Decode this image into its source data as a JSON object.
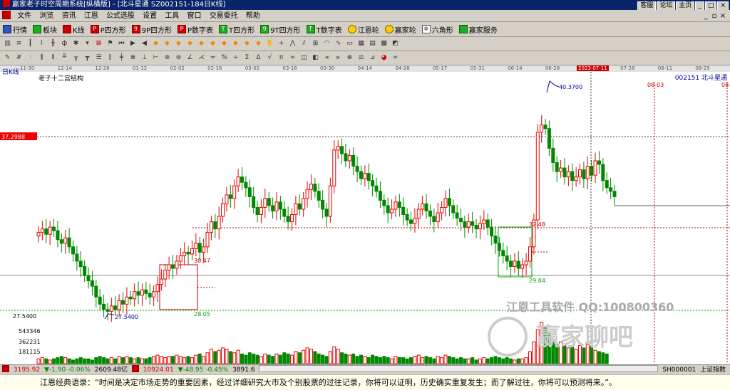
{
  "window": {
    "title": "赢家老子时空周期系统[纵横版] - [北斗星通  SZ002151-184日K线]",
    "right_buttons": [
      "客服",
      "论坛",
      "主页",
      "_",
      "□",
      "×"
    ]
  },
  "menu": [
    "文件",
    "浏览",
    "资讯",
    "江恩",
    "公式选股",
    "设置",
    "工具",
    "窗口",
    "交易委托",
    "帮助"
  ],
  "toolbar1": [
    {
      "label": "行情",
      "icon": "quote-icon"
    },
    {
      "label": "板块",
      "icon": "sector-icon"
    },
    {
      "label": "K线",
      "icon": "kline-icon"
    },
    {
      "label": "P四方形",
      "icon": "p-square-icon"
    },
    {
      "label": "9P四方形",
      "icon": "9p-square-icon"
    },
    {
      "label": "P数字表",
      "icon": "p-table-icon"
    },
    {
      "label": "T四方形",
      "icon": "t-square-icon"
    },
    {
      "label": "9T四方形",
      "icon": "9t-square-icon"
    },
    {
      "label": "T数字表",
      "icon": "t-table-icon"
    },
    {
      "label": "江恩轮",
      "icon": "gann-wheel-icon"
    },
    {
      "label": "赢家轮",
      "icon": "winner-wheel-icon"
    },
    {
      "label": "六角形",
      "icon": "hexagon-icon"
    },
    {
      "label": "赢家服务",
      "icon": "service-icon"
    }
  ],
  "date_axis": {
    "labels": [
      "11-30",
      "12-14",
      "12-28",
      "01-12",
      "02-02",
      "02-16",
      "03-02",
      "03-16",
      "03-30",
      "04-14",
      "04-28",
      "05-17",
      "05-31",
      "06-14",
      "06-28",
      "2023-07-11",
      "07-28",
      "08-11",
      "08-25"
    ],
    "selected": "2023-07-11"
  },
  "chart_header": {
    "ktype": "日K线",
    "indicator_name": "老子十二宫结构",
    "symbol": "002151  北斗星通"
  },
  "chart_data": {
    "type": "candlestick",
    "price_axis_labels": [
      "37.2988",
      "27.5400"
    ],
    "volume_axis_labels": [
      "543346",
      "362231",
      "181115"
    ],
    "annotations": [
      "40.3700",
      "27.5400",
      "30.47",
      "28.05",
      "32.48",
      "29.84",
      "08-03",
      "08-2"
    ],
    "watermark": [
      "江恩工具软件 QQ:100800360",
      "赢家聊吧"
    ],
    "closes": [
      32.2,
      32.4,
      32.1,
      32.5,
      32.3,
      31.8,
      31.6,
      31.9,
      31.4,
      31.0,
      30.6,
      30.3,
      29.8,
      29.5,
      29.2,
      28.6,
      28.2,
      27.9,
      27.8,
      28.1,
      27.9,
      28.4,
      28.2,
      28.6,
      28.5,
      28.9,
      28.7,
      29.0,
      28.8,
      28.6,
      28.9,
      29.3,
      29.6,
      30.1,
      30.4,
      30.2,
      30.6,
      30.9,
      31.1,
      31.0,
      31.3,
      31.6,
      31.1,
      31.4,
      32.2,
      32.8,
      32.4,
      33.1,
      33.8,
      34.3,
      34.1,
      34.8,
      35.3,
      35.0,
      34.7,
      34.2,
      33.6,
      33.2,
      33.6,
      34.1,
      33.7,
      33.4,
      33.9,
      33.5,
      33.1,
      32.8,
      33.2,
      33.8,
      33.5,
      34.1,
      34.6,
      34.9,
      34.5,
      34.0,
      33.5,
      33.1,
      34.8,
      36.8,
      37.0,
      36.6,
      36.2,
      36.5,
      35.9,
      35.6,
      35.2,
      35.5,
      35.1,
      34.8,
      34.5,
      34.0,
      33.7,
      33.3,
      33.5,
      33.9,
      33.6,
      33.2,
      32.9,
      32.7,
      33.0,
      33.5,
      33.8,
      33.4,
      33.1,
      32.8,
      33.3,
      33.6,
      34.1,
      33.7,
      33.3,
      33.0,
      32.8,
      32.5,
      32.8,
      32.6,
      32.4,
      32.7,
      32.9,
      32.5,
      32.0,
      31.6,
      31.2,
      30.9,
      30.6,
      30.3,
      30.6,
      30.2,
      30.4,
      30.6,
      31.4,
      32.9,
      37.8,
      38.2,
      38.0,
      36.9,
      36.1,
      35.6,
      35.8,
      35.3,
      35.6,
      35.1,
      35.3,
      35.7,
      35.2,
      35.9,
      35.4,
      36.2,
      36.0,
      35.1,
      34.7,
      34.5,
      34.2
    ],
    "volume": [
      4,
      5,
      4,
      3,
      4,
      5,
      6,
      5,
      4,
      3,
      4,
      5,
      4,
      4,
      3,
      5,
      6,
      5,
      4,
      5,
      4,
      6,
      5,
      6,
      5,
      4,
      5,
      4,
      4,
      5,
      6,
      7,
      6,
      5,
      6,
      6,
      7,
      6,
      5,
      6,
      5,
      7,
      8,
      6,
      9,
      12,
      10,
      11,
      13,
      12,
      10,
      9,
      11,
      8,
      7,
      9,
      8,
      7,
      6,
      8,
      7,
      6,
      8,
      7,
      9,
      8,
      7,
      10,
      9,
      11,
      13,
      12,
      10,
      8,
      7,
      6,
      10,
      14,
      12,
      9,
      8,
      7,
      8,
      6,
      7,
      6,
      5,
      7,
      6,
      5,
      6,
      5,
      4,
      6,
      5,
      5,
      4,
      5,
      6,
      7,
      5,
      6,
      5,
      4,
      6,
      5,
      7,
      6,
      5,
      4,
      5,
      4,
      4,
      5,
      3,
      4,
      5,
      4,
      5,
      6,
      5,
      4,
      5,
      4,
      3,
      4,
      4,
      5,
      10,
      18,
      28,
      34,
      30,
      25,
      20,
      16,
      18,
      15,
      13,
      14,
      12,
      15,
      13,
      16,
      14,
      11,
      10,
      9,
      8
    ]
  },
  "bottom_bar": {
    "sh_index": "3195.92",
    "sh_change": "▼-1.90 -0.06%",
    "sh_amount": "2609.48亿",
    "sz_index": "10924.01",
    "sz_change": "▼-48.95 -0.45%",
    "sz_amount": "3891.6",
    "right_code": "SH000001",
    "right_name": "上证指数"
  },
  "quote": "江恩经典语录：“时间是决定市场走势的重要因素，经过详细研究大市及个别股票的过往记录，你将可以证明，历史确实重复发生；而了解过往，你将可以预测将来。”。"
}
